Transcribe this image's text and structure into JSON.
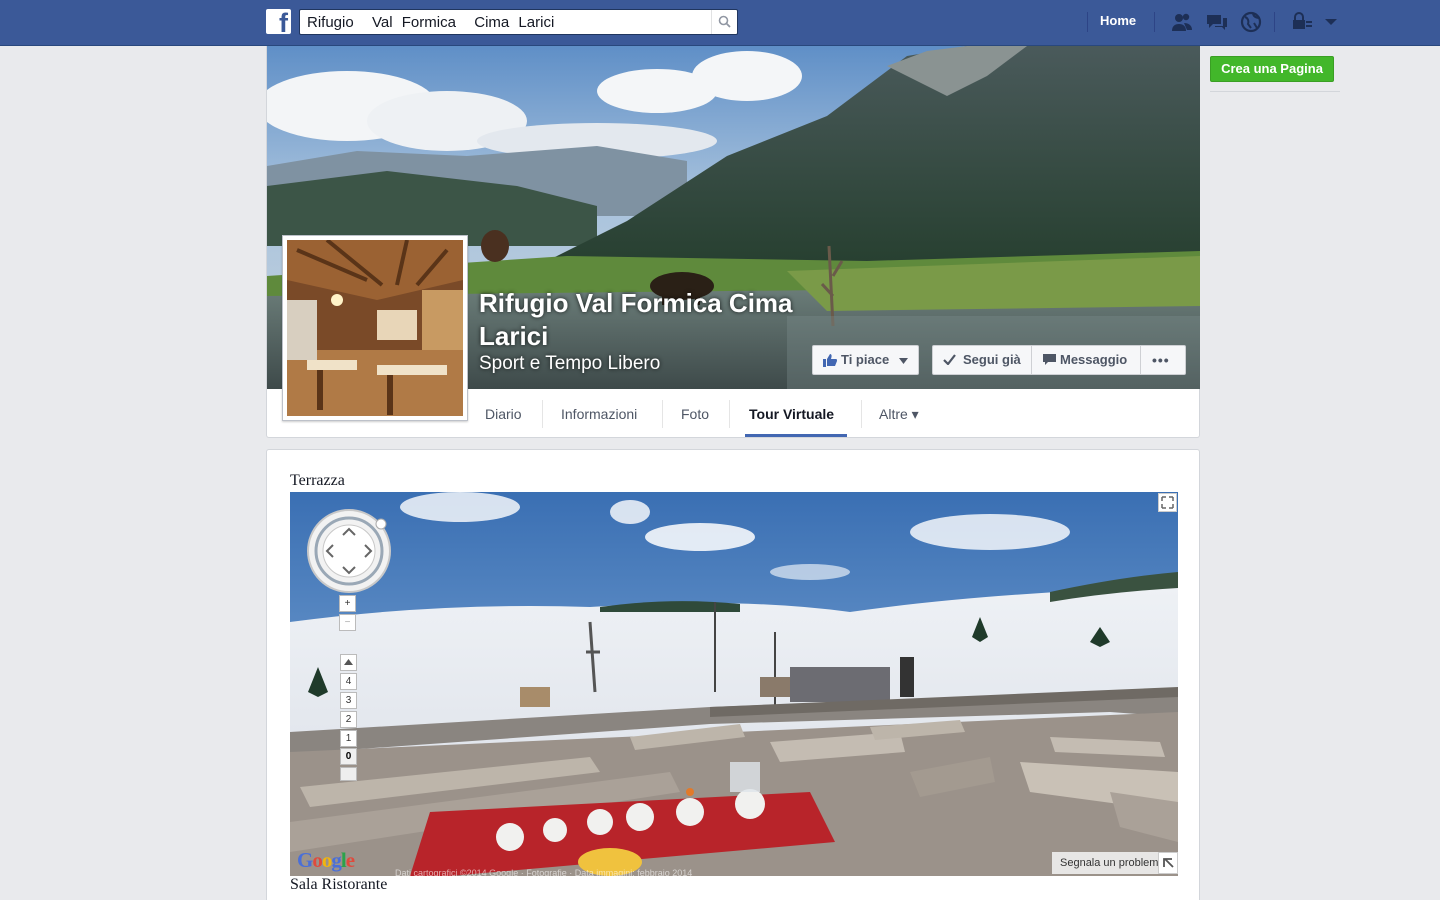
{
  "topbar": {
    "search_value": "Rifugio  Val Formica  Cima Larici",
    "home_label": "Home",
    "icons": [
      "friend-requests-icon",
      "messages-icon",
      "notifications-globe-icon",
      "privacy-lock-icon",
      "account-menu-chevron-icon"
    ]
  },
  "sidebar_right": {
    "create_page_label": "Crea una Pagina"
  },
  "page": {
    "name": "Rifugio Val Formica Cima Larici",
    "category": "Sport e Tempo Libero",
    "buttons": {
      "like": "Ti piace",
      "follow": "Segui già",
      "message": "Messaggio",
      "more": "•••"
    },
    "tabs": [
      {
        "label": "Diario"
      },
      {
        "label": "Informazioni"
      },
      {
        "label": "Foto"
      },
      {
        "label": "Tour Virtuale"
      },
      {
        "label": "Altre ▾"
      }
    ],
    "active_tab": "Tour Virtuale"
  },
  "tour": {
    "caption_top": "Terrazza",
    "caption_bottom": "Sala Ristorante",
    "levels": [
      "4",
      "3",
      "2",
      "1",
      "0"
    ],
    "selected_level": "0",
    "zoom_in": "+",
    "zoom_out": "−",
    "google_logo": "Google",
    "report_label": "Segnala un problema",
    "copyright": "Dati cartografici ©2014 Google · Fotografie · Data immagini: febbraio 2014"
  },
  "colors": {
    "fb_blue": "#3b5998",
    "green_button": "#42b72a",
    "tab_underline": "#4267b2",
    "page_bg": "#e9eaed"
  }
}
